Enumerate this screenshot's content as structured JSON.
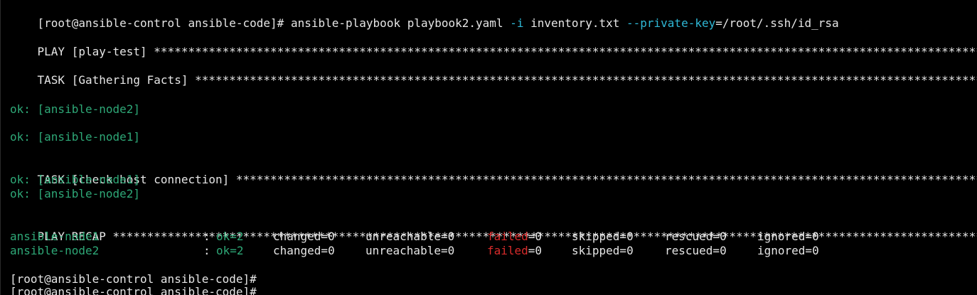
{
  "terminal": {
    "background": "#000000",
    "colors": {
      "default": "#e6e6e6",
      "flag": "#2fb8d6",
      "ok": "#2ea877",
      "failed": "#d92b2b"
    },
    "command": {
      "prompt": "[root@ansible-control ansible-code]#",
      "program": "ansible-playbook playbook2.yaml",
      "flag_inventory": "-i",
      "inventory_value": "inventory.txt",
      "flag_key": "--private-key",
      "key_value": "=/root/.ssh/id_rsa"
    },
    "play_header": "PLAY [play-test]",
    "task_gather_header": "TASK [Gathering Facts]",
    "gather_results": [
      "ok: [ansible-node2]",
      "ok: [ansible-node1]"
    ],
    "task_check_header": "TASK [check host connection]",
    "check_results": [
      "ok: [ansible-node1]",
      "ok: [ansible-node2]"
    ],
    "recap_header": "PLAY RECAP",
    "separator": "*******************************************************************************************************************************************",
    "recap": [
      {
        "host": "ansible-node1",
        "colon": ":",
        "ok": "ok=2",
        "changed": "changed=0",
        "unreachable": "unreachable=0",
        "failed_label": "failed",
        "failed_value": "=0",
        "skipped": "skipped=0",
        "rescued": "rescued=0",
        "ignored": "ignored=0"
      },
      {
        "host": "ansible-node2",
        "colon": ":",
        "ok": "ok=2",
        "changed": "changed=0",
        "unreachable": "unreachable=0",
        "failed_label": "failed",
        "failed_value": "=0",
        "skipped": "skipped=0",
        "rescued": "rescued=0",
        "ignored": "ignored=0"
      }
    ],
    "prompt_lines": [
      "[root@ansible-control ansible-code]#",
      "[root@ansible-control ansible-code]#"
    ]
  }
}
